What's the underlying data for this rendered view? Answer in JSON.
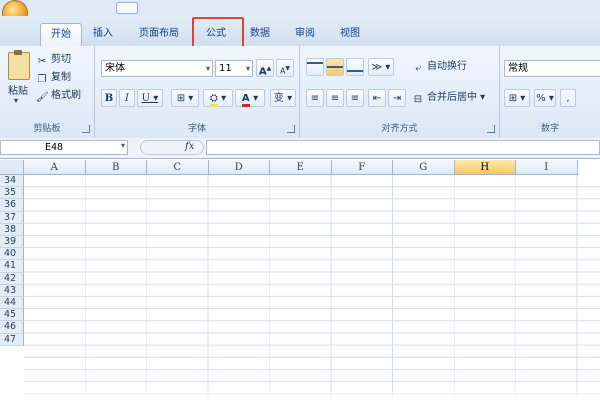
{
  "tabs": [
    {
      "label": "开始",
      "active": true
    },
    {
      "label": "插入"
    },
    {
      "label": "页面布局"
    },
    {
      "label": "公式",
      "highlighted": true
    },
    {
      "label": "数据"
    },
    {
      "label": "审阅"
    },
    {
      "label": "视图"
    }
  ],
  "clipboard": {
    "paste": "粘贴",
    "cut": "剪切",
    "copy": "复制",
    "format_painter": "格式刷",
    "group_label": "剪贴板"
  },
  "font": {
    "name": "宋体",
    "size": "11",
    "grow": "A",
    "shrink": "A",
    "bold": "B",
    "italic": "I",
    "underline": "U",
    "font_color": "A",
    "phonetic": "变",
    "group_label": "字体"
  },
  "alignment": {
    "wrap": "自动换行",
    "merge": "合并后居中",
    "group_label": "对齐方式"
  },
  "number": {
    "format": "常规",
    "percent": "%",
    "comma": ",",
    "group_label": "数字"
  },
  "formula_bar": {
    "name_box": "E48",
    "fx": "fx",
    "value": ""
  },
  "columns": [
    "A",
    "B",
    "C",
    "D",
    "E",
    "F",
    "G",
    "H",
    "I"
  ],
  "selected_column": "H",
  "rows": [
    "34",
    "35",
    "36",
    "37",
    "38",
    "39",
    "40",
    "41",
    "42",
    "43",
    "44",
    "45",
    "46",
    "47"
  ],
  "colors": {
    "accent_highlight": "#e0442a",
    "ribbon_bg": "#dbe7f5",
    "selected_header": "#f8c865"
  }
}
